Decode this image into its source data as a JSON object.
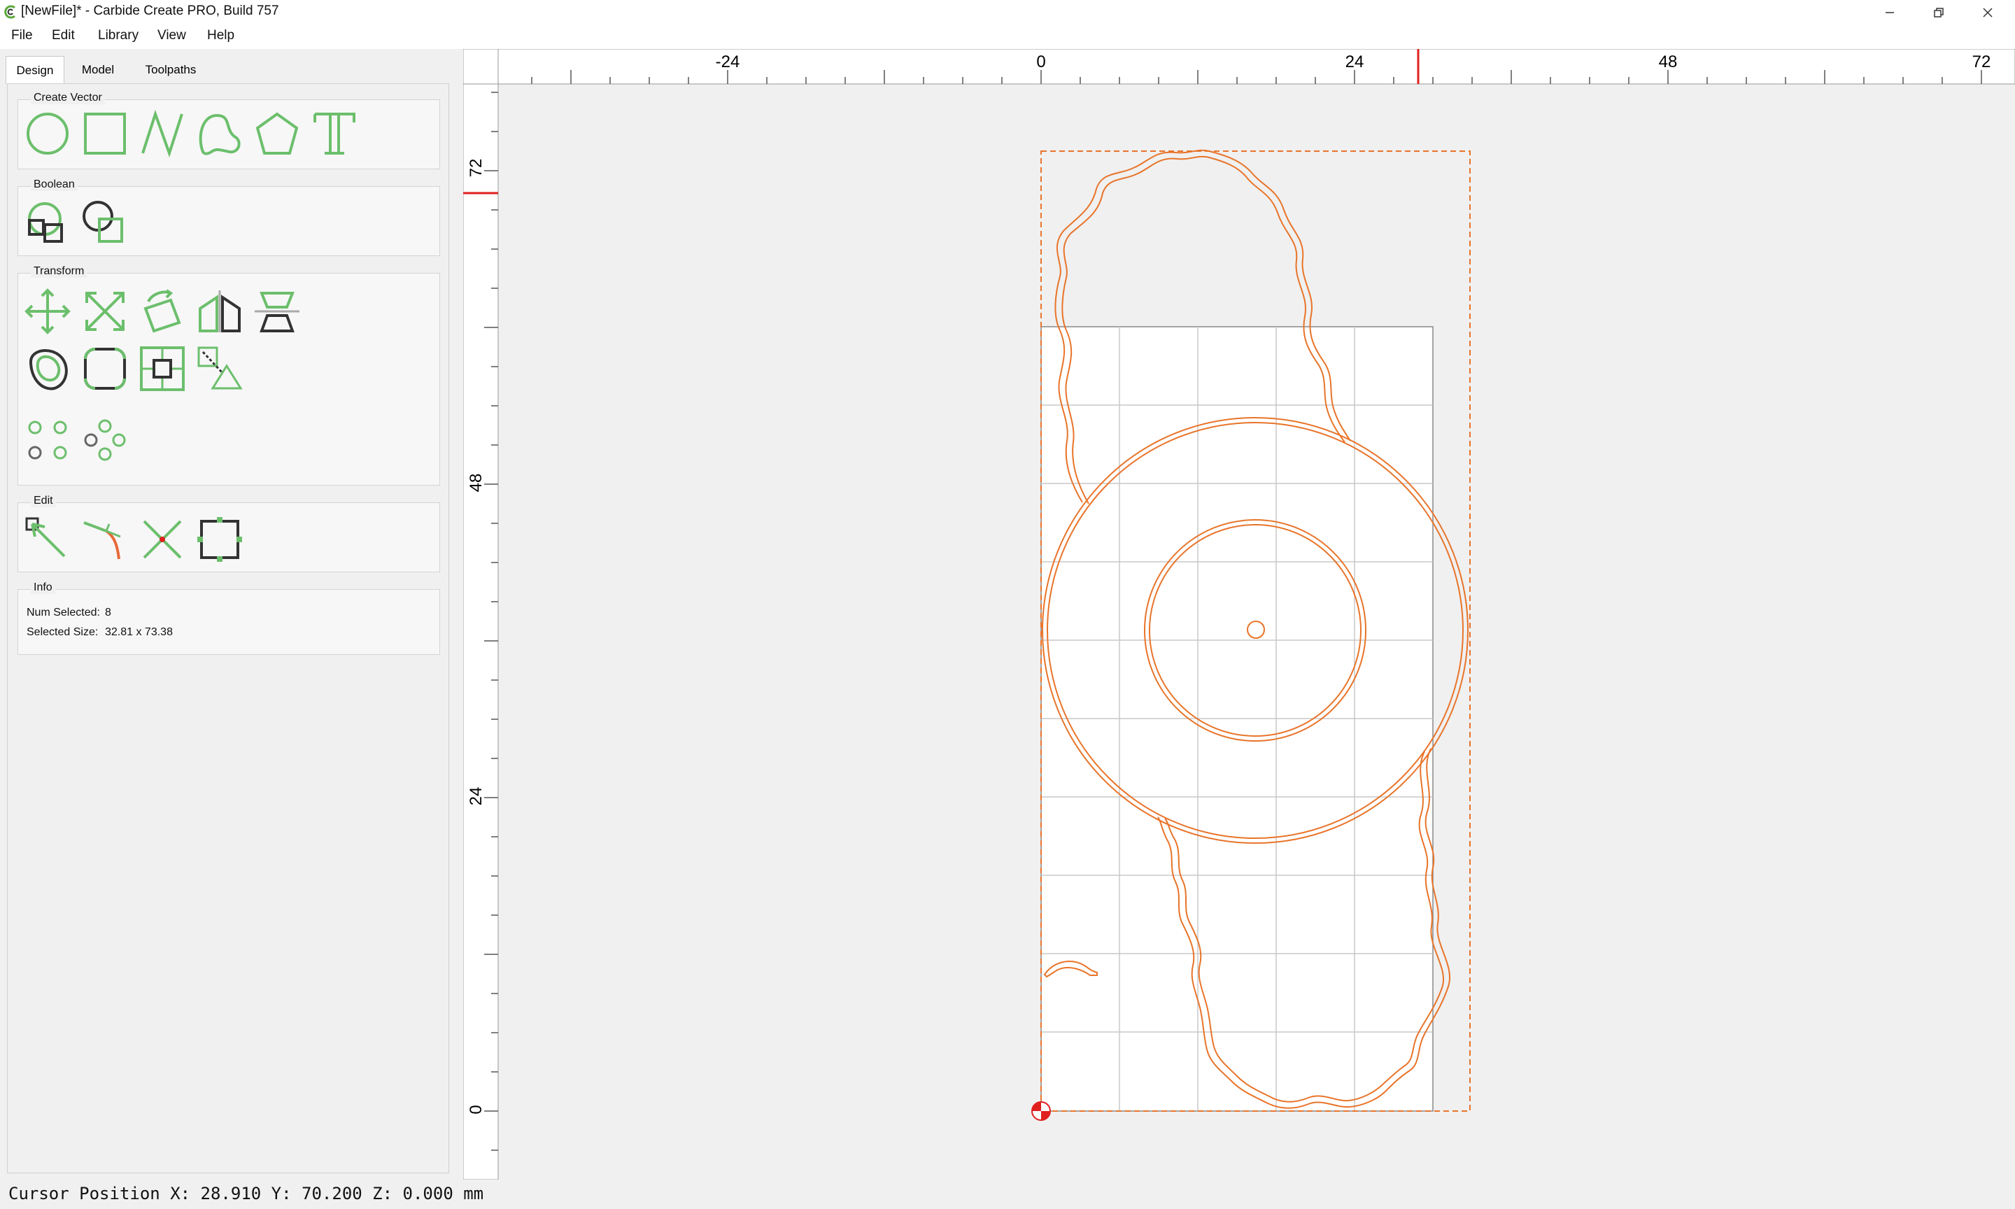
{
  "window": {
    "title": "[NewFile]* - Carbide Create PRO, Build 757",
    "icon": "carbide-logo-icon"
  },
  "menu": [
    "File",
    "Edit",
    "Library",
    "View",
    "Help"
  ],
  "tabs": [
    "Design",
    "Model",
    "Toolpaths"
  ],
  "active_tab": "Design",
  "groups": {
    "create_vector": {
      "title": "Create Vector",
      "tools": [
        "circle-tool-icon",
        "rectangle-tool-icon",
        "polyline-tool-icon",
        "curve-tool-icon",
        "polygon-tool-icon",
        "text-tool-icon"
      ]
    },
    "boolean": {
      "title": "Boolean",
      "tools": [
        "boolean-union-icon",
        "boolean-subtract-icon"
      ]
    },
    "transform": {
      "title": "Transform",
      "tools": [
        "move-icon",
        "scale-icon",
        "rotate-icon",
        "mirror-icon",
        "align-icon",
        "offset-icon",
        "fillet-icon",
        "center-icon",
        "distort-icon",
        "array-icon",
        "circular-array-icon"
      ]
    },
    "edit": {
      "title": "Edit",
      "tools": [
        "edit-nodes-icon",
        "bezier-edit-icon",
        "trim-icon",
        "bounding-box-icon"
      ]
    },
    "info": {
      "title": "Info",
      "num_selected_label": "Num Selected:",
      "num_selected": "8",
      "selected_size_label": "Selected Size:",
      "selected_size": "32.81 x 73.38"
    }
  },
  "rulers": {
    "horizontal_labels": [
      "-24",
      "0",
      "24",
      "48",
      "72"
    ],
    "vertical_labels": [
      "72",
      "48",
      "24",
      "0"
    ]
  },
  "colors": {
    "accent_green": "#6cbf6c",
    "vector_orange": "#e8742a",
    "cursor_red": "#e0201f",
    "grid": "#c8c8c8"
  },
  "status": {
    "cursor_position": "Cursor Position X: 28.910 Y: 70.200 Z: 0.000 mm"
  }
}
